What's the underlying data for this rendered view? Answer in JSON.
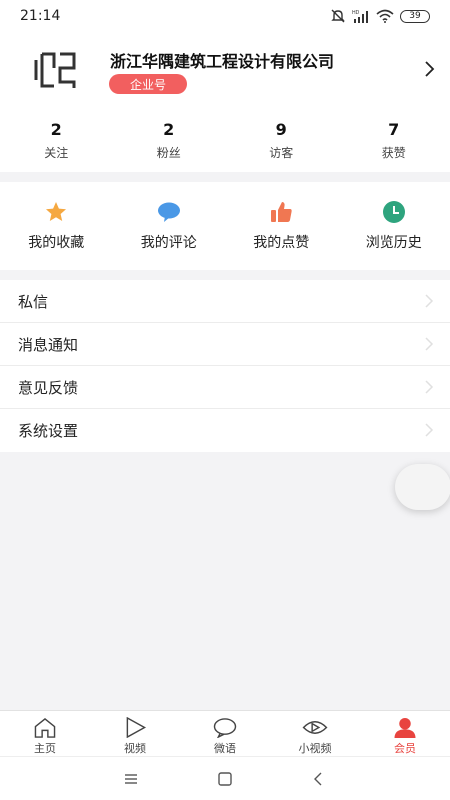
{
  "status_bar": {
    "time": "21:14",
    "battery": "39"
  },
  "profile": {
    "company_name": "浙江华隅建筑工程设计有限公司",
    "badge": "企业号",
    "stats": [
      {
        "value": "2",
        "label": "关注"
      },
      {
        "value": "2",
        "label": "粉丝"
      },
      {
        "value": "9",
        "label": "访客"
      },
      {
        "value": "7",
        "label": "获赞"
      }
    ]
  },
  "quick_actions": [
    {
      "label": "我的收藏",
      "icon": "star-icon",
      "color": "#f5a841"
    },
    {
      "label": "我的评论",
      "icon": "comment-icon",
      "color": "#4a98e6"
    },
    {
      "label": "我的点赞",
      "icon": "thumbs-up-icon",
      "color": "#f07752"
    },
    {
      "label": "浏览历史",
      "icon": "clock-icon",
      "color": "#2ea47e"
    }
  ],
  "menu": [
    {
      "label": "私信"
    },
    {
      "label": "消息通知"
    },
    {
      "label": "意见反馈"
    },
    {
      "label": "系统设置"
    }
  ],
  "tab_bar": [
    {
      "label": "主页",
      "icon": "home-icon"
    },
    {
      "label": "视频",
      "icon": "play-icon"
    },
    {
      "label": "微语",
      "icon": "chat-bubble-icon"
    },
    {
      "label": "小视频",
      "icon": "eye-play-icon"
    },
    {
      "label": "会员",
      "icon": "person-icon",
      "active": true
    }
  ],
  "colors": {
    "accent": "#e8443f",
    "badge": "#f25f5f",
    "background": "#f3f3f5"
  }
}
